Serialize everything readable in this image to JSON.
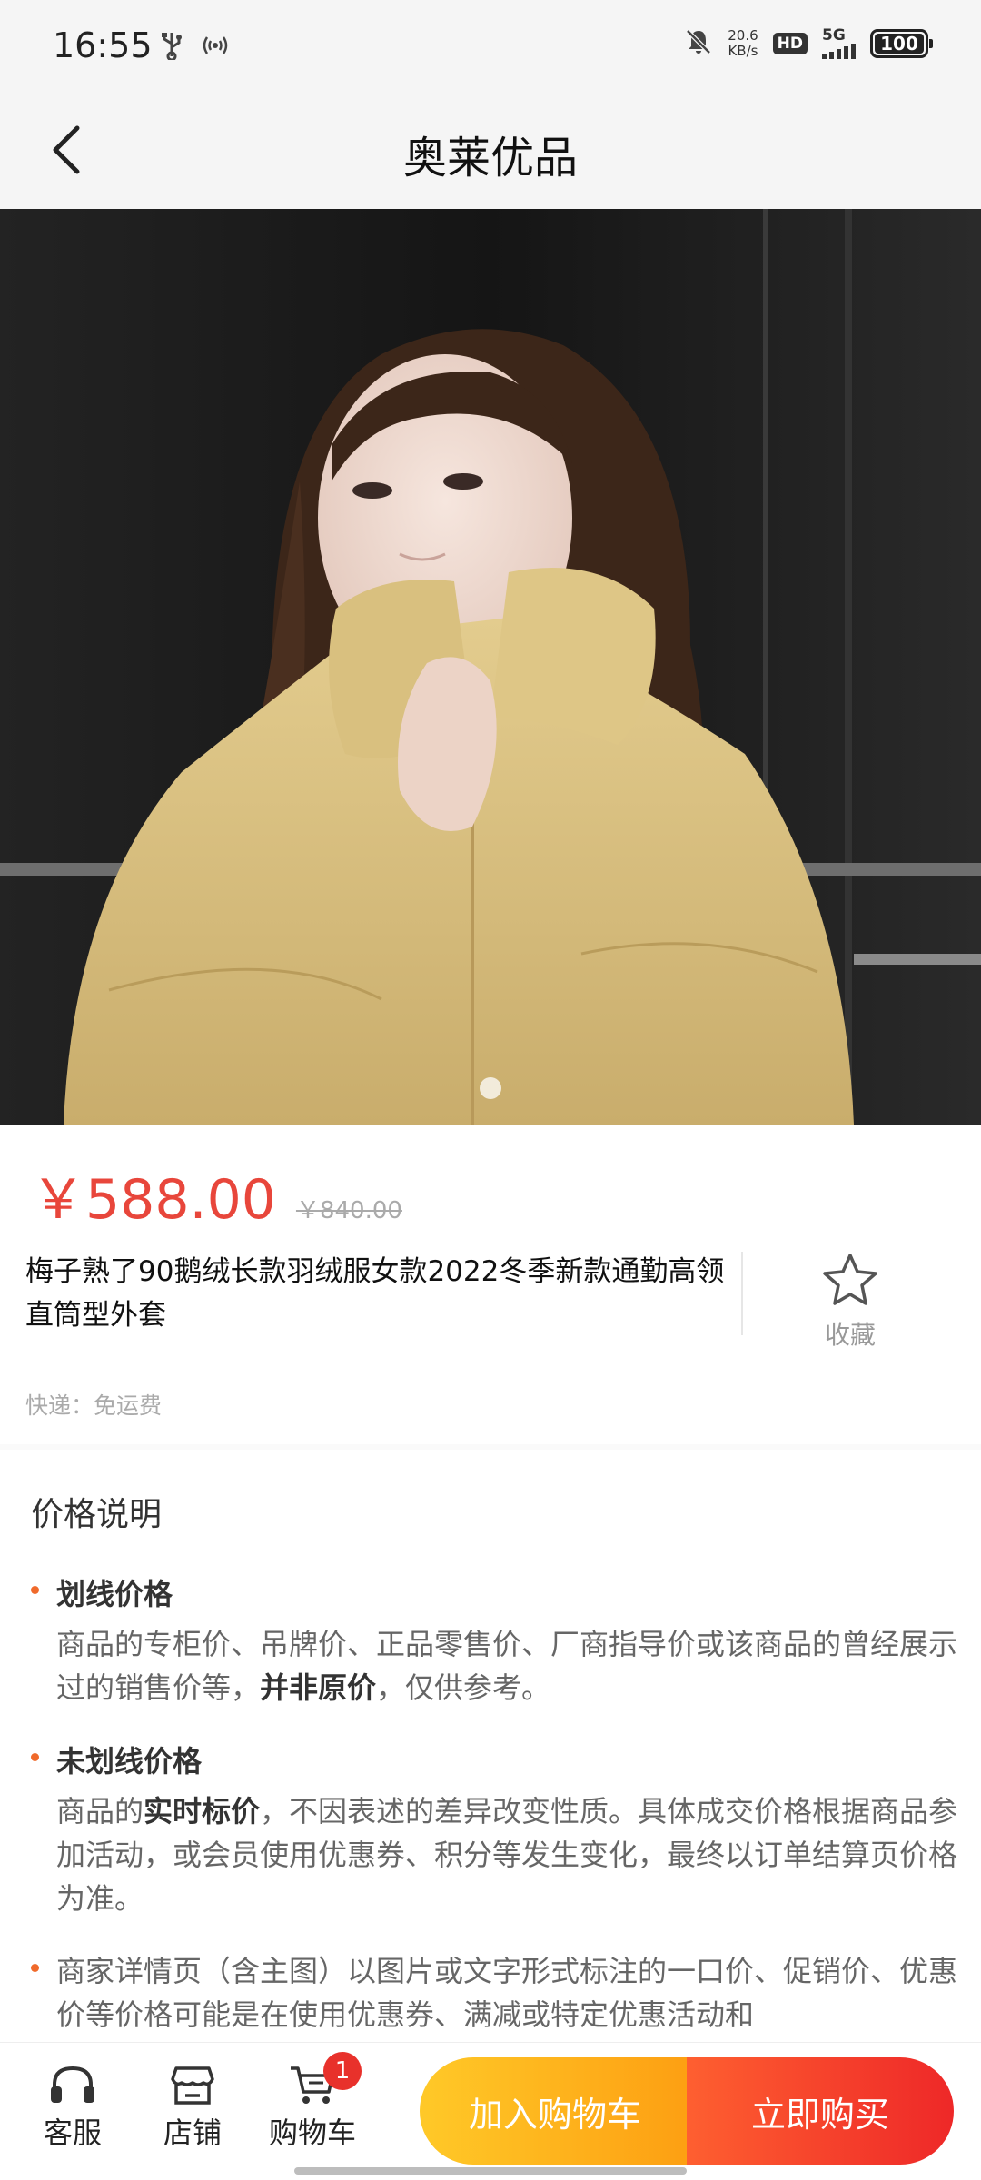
{
  "status_bar": {
    "time": "16:55",
    "net_speed_value": "20.6",
    "net_speed_unit": "KB/s",
    "hd_label": "HD",
    "network": "5G",
    "battery": "100"
  },
  "nav": {
    "title": "奥莱优品"
  },
  "product": {
    "price_current": "￥588.00",
    "price_original": "￥840.00",
    "title": "梅子熟了90鹅绒长款羽绒服女款2022冬季新款通勤高领直筒型外套",
    "favorite_label": "收藏",
    "shipping": "快递：免运费"
  },
  "price_explanation": {
    "title": "价格说明",
    "items": [
      {
        "heading": "划线价格",
        "text_a": "商品的专柜价、吊牌价、正品零售价、厂商指导价或该商品的曾经展示过的销售价等，",
        "text_bold": "并非原价",
        "text_b": "，仅供参考。"
      },
      {
        "heading": "未划线价格",
        "text_a": "商品的",
        "text_bold": "实时标价",
        "text_b": "，不因表述的差异改变性质。具体成交价格根据商品参加活动，或会员使用优惠券、积分等发生变化，最终以订单结算页价格为准。"
      },
      {
        "text": "商家详情页（含主图）以图片或文字形式标注的一口价、促销价、优惠价等价格可能是在使用优惠券、满减或特定优惠活动和"
      }
    ]
  },
  "bottom_bar": {
    "service_label": "客服",
    "store_label": "店铺",
    "cart_label": "购物车",
    "cart_count": "1",
    "add_to_cart_label": "加入购物车",
    "buy_now_label": "立即购买"
  },
  "colors": {
    "price_red": "#e8463b",
    "add_to_cart_gradient": [
      "#ffc928",
      "#fd9f12"
    ],
    "buy_now_gradient": [
      "#fe5f30",
      "#ee2828"
    ],
    "bullet_orange": "#f06a2b"
  },
  "icons": {
    "back": "chevron-left-icon",
    "favorite": "star-outline-icon",
    "service": "headset-icon",
    "store": "store-icon",
    "cart": "cart-icon"
  }
}
